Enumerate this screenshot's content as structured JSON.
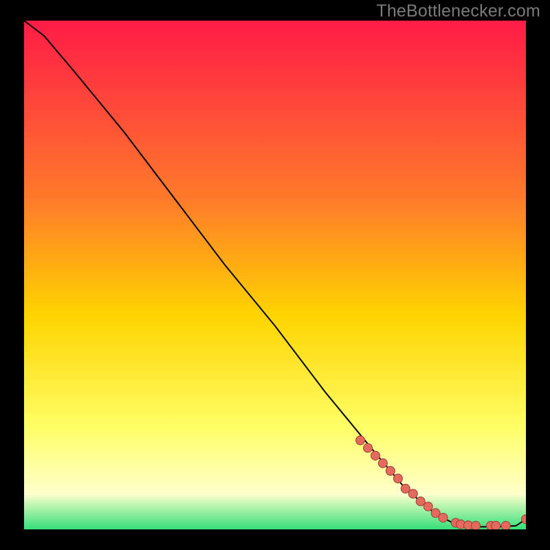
{
  "watermark": "TheBottlenecker.com",
  "chart_data": {
    "type": "line",
    "title": "",
    "xlabel": "",
    "ylabel": "",
    "xlim": [
      0,
      100
    ],
    "ylim": [
      0,
      100
    ],
    "grid": false,
    "curve": {
      "name": "bottleneck-curve",
      "x": [
        0,
        4,
        10,
        20,
        30,
        40,
        50,
        60,
        70,
        76,
        82,
        86,
        90,
        94,
        98,
        100
      ],
      "y": [
        100,
        97,
        90,
        78,
        65,
        52,
        40,
        27,
        15,
        8,
        3,
        1,
        0.5,
        0.5,
        0.7,
        2
      ]
    },
    "points": {
      "name": "marker-points",
      "x": [
        67,
        68.5,
        70,
        71.5,
        73,
        74.5,
        76,
        77.5,
        79,
        80.5,
        82,
        83.5,
        86,
        87,
        88.5,
        90,
        93,
        94,
        96,
        100
      ],
      "y": [
        17.5,
        16,
        14.5,
        13,
        11.5,
        10,
        8,
        7,
        5.5,
        4.5,
        3.2,
        2.3,
        1.3,
        1,
        0.8,
        0.7,
        0.7,
        0.7,
        0.7,
        2
      ]
    },
    "colors": {
      "gradient_top": "#ff1b47",
      "gradient_mid_upper": "#ff7a2a",
      "gradient_mid": "#ffd400",
      "gradient_mid_lower": "#ffff66",
      "gradient_low": "#ffffcc",
      "gradient_bottom": "#34e07a",
      "curve_stroke": "#000000",
      "point_fill": "#e46a5e",
      "point_stroke": "#9c3d35"
    }
  }
}
